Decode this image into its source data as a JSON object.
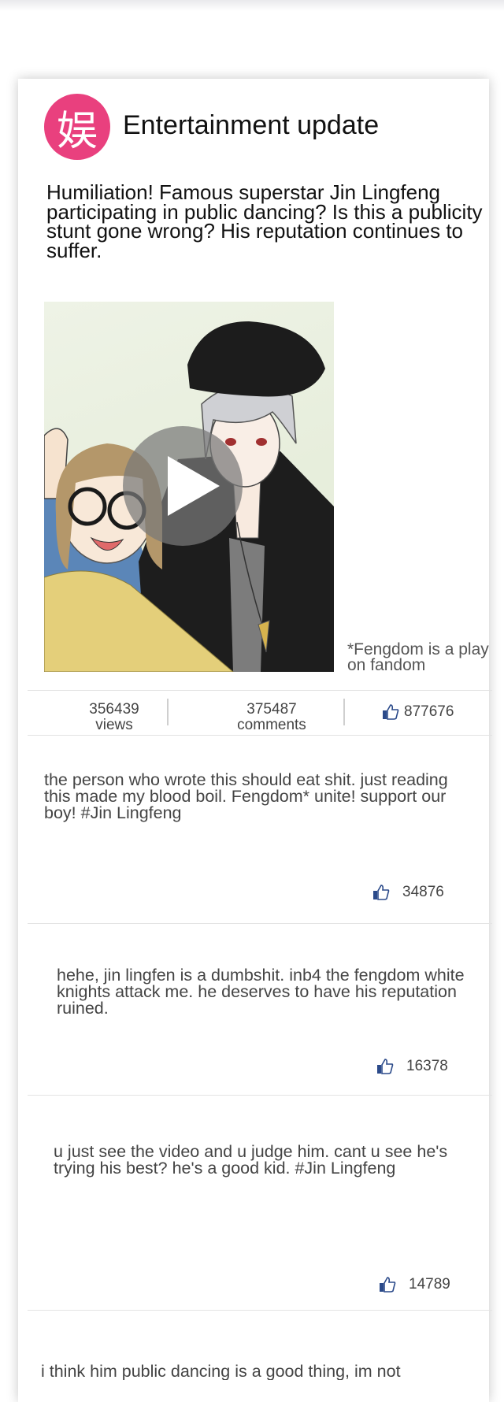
{
  "app": {
    "logo_char": "娱",
    "title": "Entertainment update"
  },
  "article": {
    "headline": "Humiliation! Famous superstar Jin Lingfeng participating in public dancing? Is this a publicity stunt gone wrong? His reputation continues to suffer.",
    "footnote": "*Fengdom is a play on fandom"
  },
  "stats": {
    "views_count": "356439",
    "views_label": "views",
    "comments_count": "375487",
    "comments_label": "comments",
    "likes_count": "877676"
  },
  "comments": [
    {
      "text": "the person who wrote this should eat shit. just reading this made my blood boil. Fengdom* unite! support our boy! #Jin Lingfeng",
      "likes": "34876"
    },
    {
      "text": "hehe, jin lingfen is a dumbshit. inb4 the fengdom white knights attack me. he deserves to have his reputation ruined.",
      "likes": "16378"
    },
    {
      "text": "u just see the video and u judge him. cant u see he's trying his best? he's a good kid. #Jin Lingfeng",
      "likes": "14789"
    },
    {
      "text": "i think him public dancing is a good thing, im not",
      "likes": ""
    }
  ],
  "colors": {
    "logo_bg": "#e9407e",
    "thumb_icon": "#2b4a8a"
  },
  "icons": {
    "like": "thumbs-up-icon",
    "play": "play-icon"
  }
}
